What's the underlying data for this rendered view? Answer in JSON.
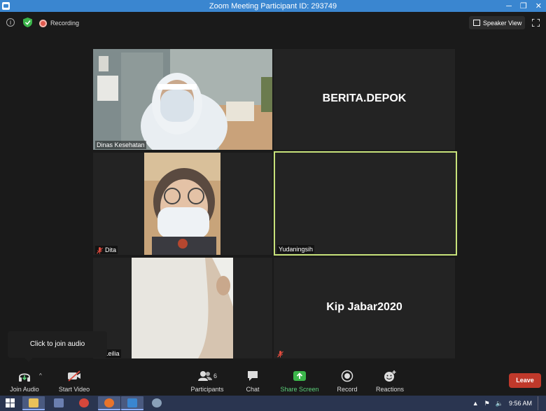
{
  "window": {
    "title": "Zoom Meeting Participant ID: 293749",
    "controls": [
      "─",
      "❐",
      "✕"
    ]
  },
  "top": {
    "recording_label": "Recording",
    "speaker_view_label": "Speaker View"
  },
  "participants": [
    {
      "name": "Dinas Kesehatan",
      "has_video": true
    },
    {
      "name": "BERITA.DEPOK",
      "has_video": false
    },
    {
      "name": "Dita",
      "has_video": true,
      "muted": true
    },
    {
      "name": "Yudaningsih",
      "has_video": false,
      "active_speaker": true
    },
    {
      "name": "eli Leilia",
      "has_video": true
    },
    {
      "name": "Kip Jabar2020",
      "has_video": false,
      "muted": true
    }
  ],
  "tooltip": {
    "text": "Click to join audio"
  },
  "toolbar": {
    "join_audio": "Join Audio",
    "start_video": "Start Video",
    "participants": "Participants",
    "participants_count": "6",
    "chat": "Chat",
    "share_screen": "Share Screen",
    "record": "Record",
    "reactions": "Reactions",
    "leave": "Leave"
  },
  "taskbar": {
    "time": "9:56 AM"
  },
  "colors": {
    "accent_green": "#5cd07a",
    "leave_red": "#c0392b",
    "active_border": "#c7e27a",
    "titlebar": "#3a86d0"
  }
}
